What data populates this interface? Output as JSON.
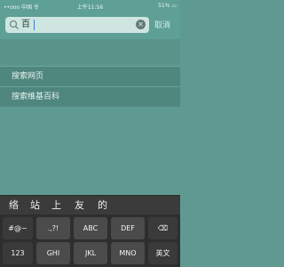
{
  "status_bar": {
    "left": "••ooo 中国 令",
    "time": "上午11:56",
    "right": "51% ▭"
  },
  "search": {
    "query": "百",
    "cancel_label": "取消"
  },
  "results": [
    {
      "label": "搜索网页"
    },
    {
      "label": "搜索维基百科"
    }
  ],
  "candidates": [
    "络",
    "站",
    "上",
    "友",
    "的"
  ],
  "keyboard": {
    "row1": [
      "#@~",
      ".,?!",
      "ABC",
      "DEF"
    ],
    "row2": [
      "123",
      "GHI",
      "JKL",
      "MNO",
      "英文"
    ],
    "backspace": "⌫"
  },
  "colors": {
    "accent": "#5fa096",
    "keyboard_bg": "#2e2e2e"
  }
}
